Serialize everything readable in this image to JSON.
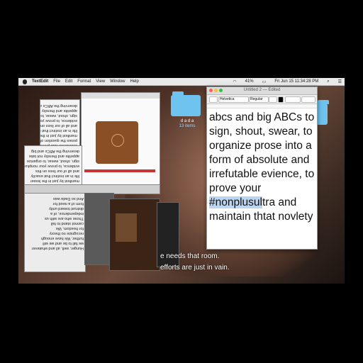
{
  "menubar": {
    "app": "TextEdit",
    "items": [
      "File",
      "Edit",
      "Format",
      "View",
      "Window",
      "Help"
    ],
    "clock": "Fri Jun 15  11:34:28 PM",
    "battery": "41%"
  },
  "desktop": {
    "folder_label": "d a d a",
    "folder_sub": "13 items"
  },
  "editor": {
    "title": "Untitled 2 — Edited",
    "font": "Helvetica",
    "style": "Regular",
    "text_before": "abcs and big ABCs to sign, shout, swear, to organize prose into a form of absolute and irrefutable evience, to prove your ",
    "highlight": "#nonplusul",
    "text_after": "tra and maintain thtat novlety"
  },
  "mirrored": {
    "block1": "excellence was previously\nposes the question of God-The\nmanifest by just in the lesser\nlife in an instinct that exactly\nand all of our lives on this\nevidence, to prove your nonplus\nsign, shout, swear, to organize\nappetite and thereby not take\ndeserving the ABCs and big",
    "block2": "Hunger, well, all and whatever\nwe fall to be and we will\nfurther, We have enough\nrecognize no theory\nfor freedom, We\ncannot stand to fall\nThose who are with us\nindependence, of a\ndistrust toward unity\nform of a need for\nAnd so Dada was"
  },
  "subtitles": {
    "line1": "e needs that room.",
    "line2": "efforts are just in vain."
  }
}
